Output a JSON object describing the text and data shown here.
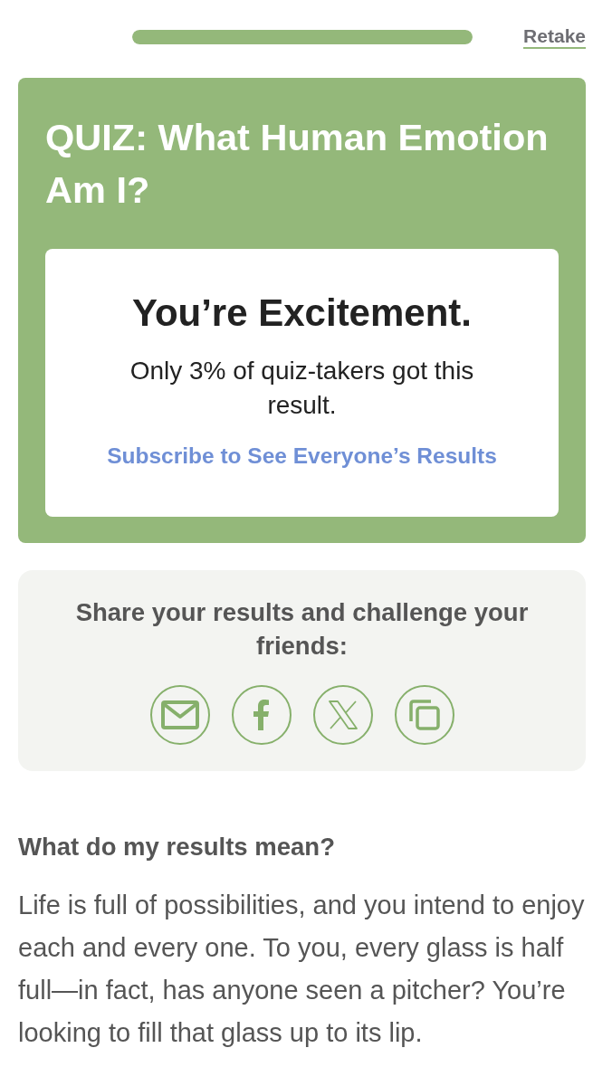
{
  "progress": {
    "level": 1
  },
  "retake": "Retake",
  "quiz": {
    "title": "QUIZ: What Human Emotion Am I?",
    "result": {
      "heading": "You’re Excitement.",
      "note": "Only 3% of quiz-takers got this result.",
      "link": "Subscribe to See Everyone’s Results"
    }
  },
  "share": {
    "prompt": "Share your results and challenge your friends:",
    "buttons": [
      {
        "kind": "email"
      },
      {
        "kind": "facebook"
      },
      {
        "kind": "x"
      },
      {
        "kind": "copy"
      }
    ]
  },
  "meaning": {
    "heading": "What do my results mean?",
    "body": "Life is full of possibilities, and you intend to enjoy each and every one. To you, every glass is half full—in fact, has anyone seen a pitcher? You’re looking to fill that glass up to its lip."
  }
}
